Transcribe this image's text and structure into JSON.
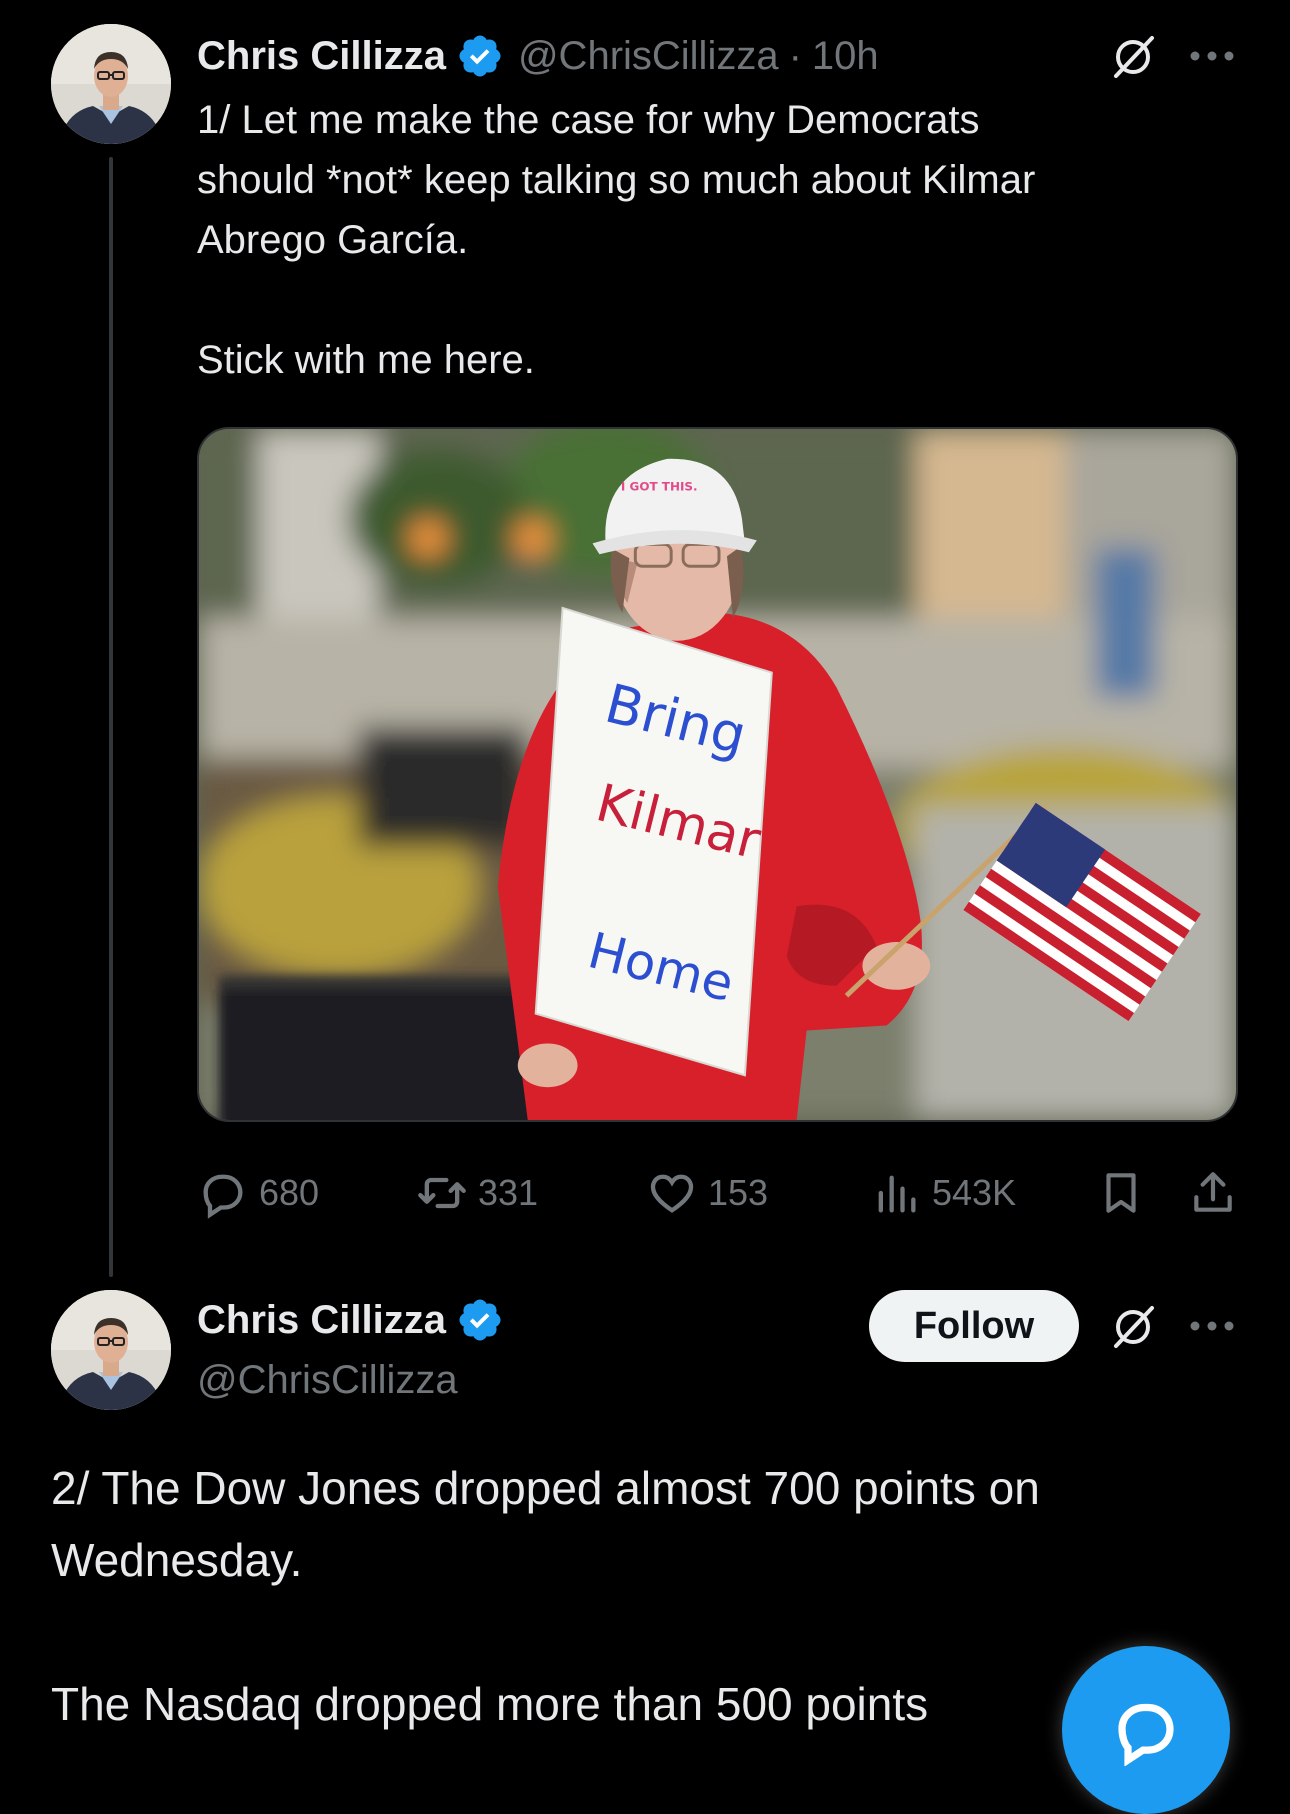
{
  "tweet1": {
    "author": {
      "name": "Chris Cillizza",
      "handle": "@ChrisCillizza",
      "time_separator": "·",
      "time": "10h",
      "verified": true
    },
    "text": "1/ Let me make the case for why Democrats\nshould *not* keep talking so much about Kilmar\nAbrego García.\n\nStick with me here.",
    "media": {
      "sign_lines": [
        "Bring",
        "Kilmar",
        "Home"
      ],
      "hat_text": "I GOT THIS."
    },
    "actions": {
      "replies": "680",
      "reposts": "331",
      "likes": "153",
      "views": "543K"
    }
  },
  "tweet2": {
    "author": {
      "name": "Chris Cillizza",
      "handle": "@ChrisCillizza",
      "verified": true
    },
    "follow_label": "Follow",
    "text": "2/ The Dow Jones dropped almost 700 points on\nWednesday.\n\nThe Nasdaq dropped more than 500 points"
  },
  "icons": {
    "verified": "verified-badge-icon",
    "grok": "grok-icon",
    "more": "more-options-icon",
    "reply": "reply-icon",
    "repost": "repost-icon",
    "like": "like-icon",
    "views": "views-icon",
    "bookmark": "bookmark-icon",
    "share": "share-icon",
    "compose": "compose-reply-fab-icon"
  },
  "colors": {
    "background": "#000000",
    "text": "#e7e9ea",
    "secondary": "#71767b",
    "accent": "#1d9bf0",
    "follow_bg": "#eff3f4"
  }
}
